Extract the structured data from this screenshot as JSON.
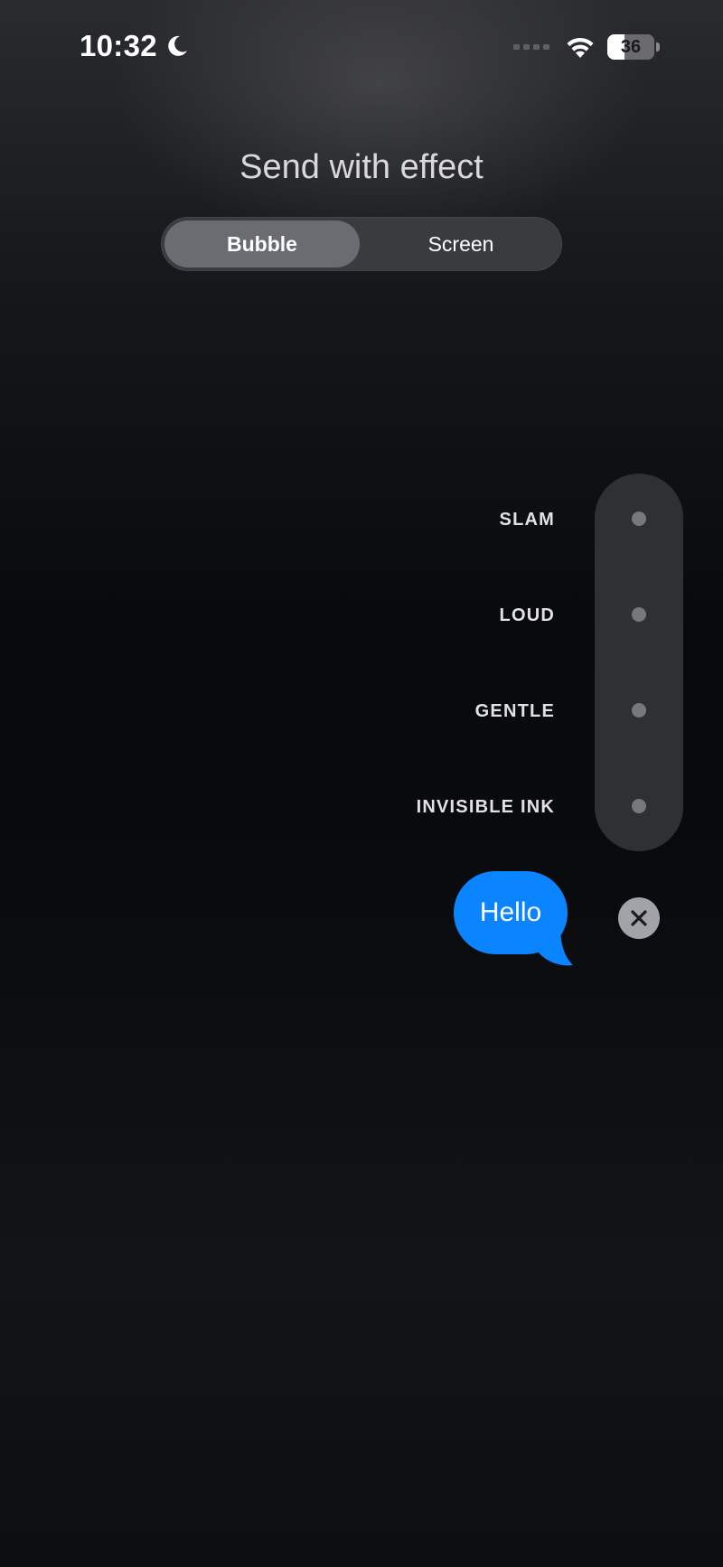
{
  "status_bar": {
    "time": "10:32",
    "battery_percent": "36",
    "battery_level": 0.36,
    "icons": [
      "moon-icon",
      "cellular-signal-icon",
      "wifi-icon",
      "battery-icon"
    ]
  },
  "header": {
    "title": "Send with effect"
  },
  "tabs": [
    {
      "label": "Bubble",
      "selected": true
    },
    {
      "label": "Screen",
      "selected": false
    }
  ],
  "effects": [
    {
      "label": "SLAM"
    },
    {
      "label": "LOUD"
    },
    {
      "label": "GENTLE"
    },
    {
      "label": "INVISIBLE INK"
    }
  ],
  "message": {
    "text": "Hello"
  },
  "colors": {
    "bubble": "#0a84ff",
    "background": "#0d0f12",
    "cancel_button": "#a2a3a8"
  },
  "actions": {
    "cancel_icon": "close-icon"
  }
}
